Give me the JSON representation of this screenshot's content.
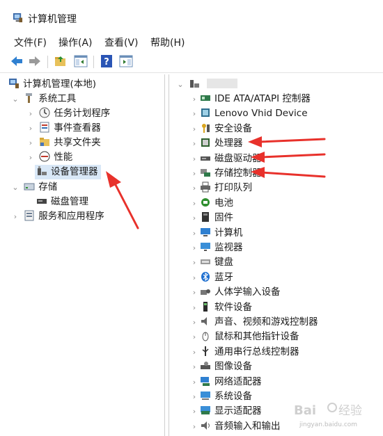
{
  "window": {
    "title": "计算机管理"
  },
  "menu": [
    "文件(F)",
    "操作(A)",
    "查看(V)",
    "帮助(H)"
  ],
  "toolbar": {
    "buttons": [
      "back-icon",
      "forward-icon",
      "up-folder-icon",
      "show-hide-tree-icon",
      "help-icon",
      "show-action-pane-icon"
    ]
  },
  "left_tree": {
    "root": "计算机管理(本地)",
    "system_tools": "系统工具",
    "task_scheduler": "任务计划程序",
    "event_viewer": "事件查看器",
    "shared_folders": "共享文件夹",
    "performance": "性能",
    "device_manager": "设备管理器",
    "storage": "存储",
    "disk_management": "磁盘管理",
    "services_apps": "服务和应用程序"
  },
  "device_tree": {
    "root": "",
    "categories": [
      {
        "label": "IDE ATA/ATAPI 控制器",
        "icon": "ide-controller-icon"
      },
      {
        "label": "Lenovo Vhid Device",
        "icon": "hid-device-icon"
      },
      {
        "label": "安全设备",
        "icon": "security-device-icon"
      },
      {
        "label": "处理器",
        "icon": "processor-icon"
      },
      {
        "label": "磁盘驱动器",
        "icon": "disk-drive-icon"
      },
      {
        "label": "存储控制器",
        "icon": "storage-controller-icon"
      },
      {
        "label": "打印队列",
        "icon": "printer-icon"
      },
      {
        "label": "电池",
        "icon": "battery-icon"
      },
      {
        "label": "固件",
        "icon": "firmware-icon"
      },
      {
        "label": "计算机",
        "icon": "computer-icon"
      },
      {
        "label": "监视器",
        "icon": "monitor-icon"
      },
      {
        "label": "键盘",
        "icon": "keyboard-icon"
      },
      {
        "label": "蓝牙",
        "icon": "bluetooth-icon"
      },
      {
        "label": "人体学输入设备",
        "icon": "hid-input-icon"
      },
      {
        "label": "软件设备",
        "icon": "software-device-icon"
      },
      {
        "label": "声音、视频和游戏控制器",
        "icon": "sound-icon"
      },
      {
        "label": "鼠标和其他指针设备",
        "icon": "mouse-icon"
      },
      {
        "label": "通用串行总线控制器",
        "icon": "usb-icon"
      },
      {
        "label": "图像设备",
        "icon": "camera-icon"
      },
      {
        "label": "网络适配器",
        "icon": "network-adapter-icon"
      },
      {
        "label": "系统设备",
        "icon": "system-device-icon"
      },
      {
        "label": "显示适配器",
        "icon": "display-adapter-icon"
      },
      {
        "label": "音频输入和输出",
        "icon": "audio-io-icon"
      }
    ]
  },
  "watermark": {
    "brand": "Baidu 经验",
    "url": "jingyan.baidu.com"
  },
  "colors": {
    "arrow": "#e8312b",
    "selection": "#d9e8f7",
    "nav_arrow": "#2f80d1"
  }
}
